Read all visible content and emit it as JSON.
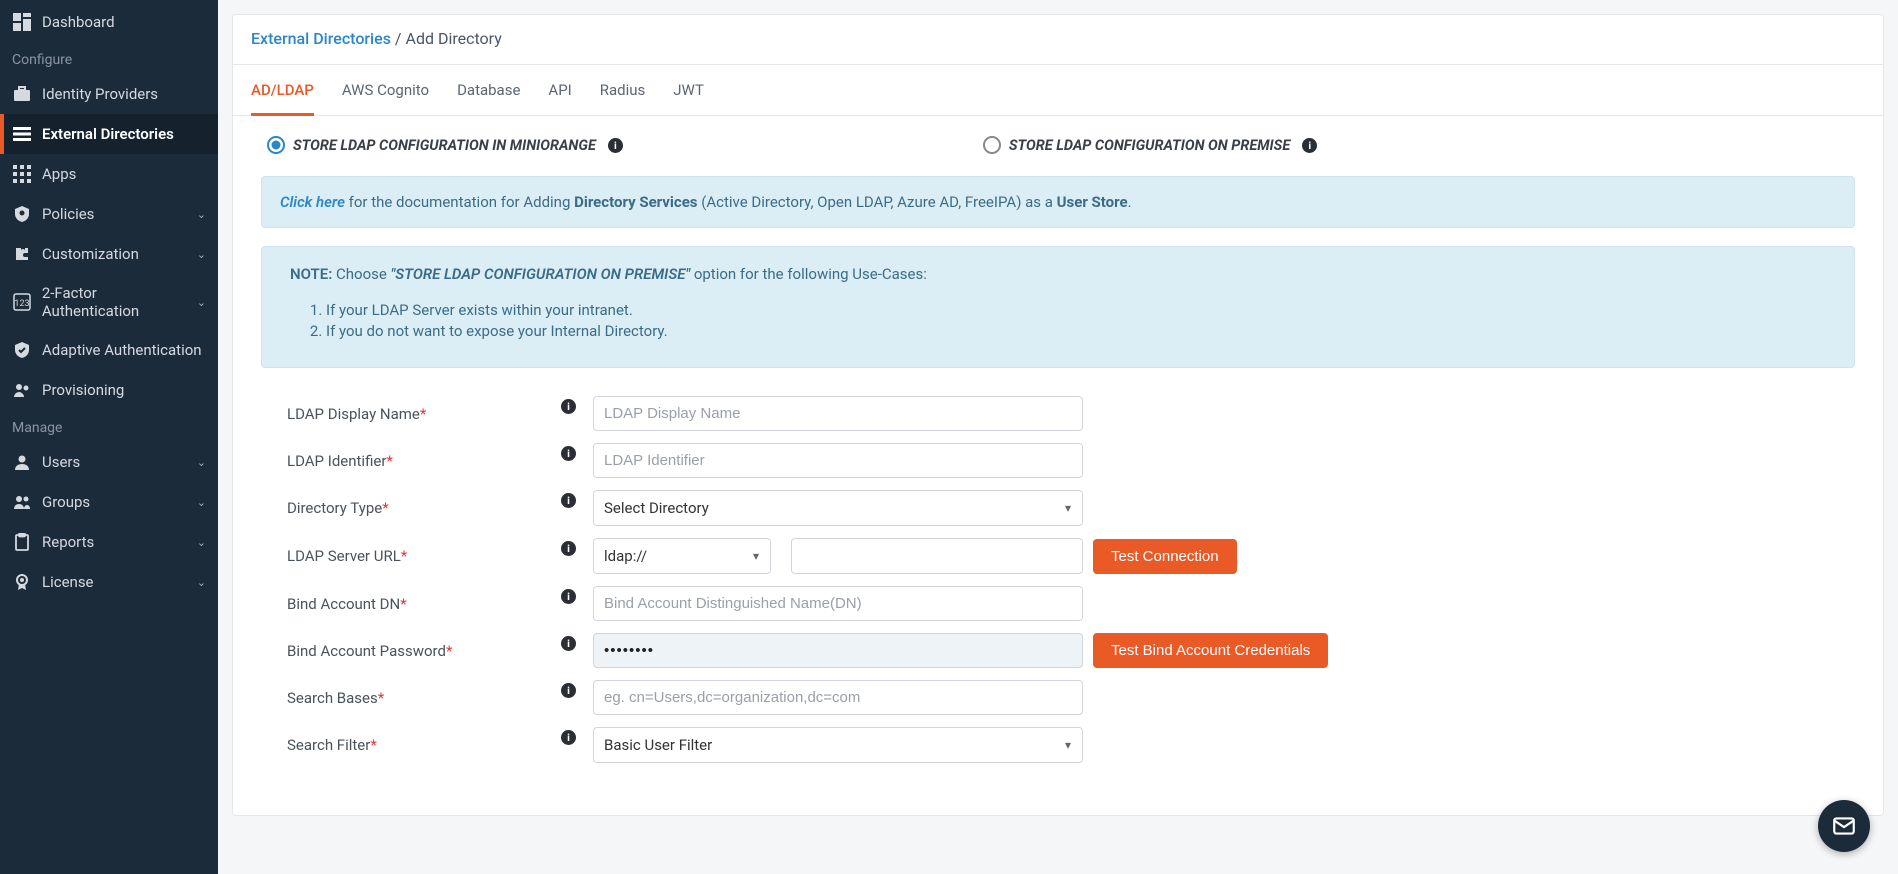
{
  "sidebar": {
    "items": [
      {
        "label": "Dashboard",
        "icon": "dashboard",
        "chev": false,
        "active": false
      },
      {
        "section": "Configure"
      },
      {
        "label": "Identity Providers",
        "icon": "briefcase",
        "chev": false,
        "active": false
      },
      {
        "label": "External Directories",
        "icon": "list",
        "chev": false,
        "active": true
      },
      {
        "label": "Apps",
        "icon": "grid",
        "chev": false,
        "active": false
      },
      {
        "label": "Policies",
        "icon": "shield-gear",
        "chev": true,
        "active": false
      },
      {
        "label": "Customization",
        "icon": "puzzle",
        "chev": true,
        "active": false
      },
      {
        "label": "2-Factor Authentication",
        "icon": "keypad",
        "chev": true,
        "active": false
      },
      {
        "label": "Adaptive Authentication",
        "icon": "shield-check",
        "chev": false,
        "active": false
      },
      {
        "label": "Provisioning",
        "icon": "users-gear",
        "chev": false,
        "active": false
      },
      {
        "section": "Manage"
      },
      {
        "label": "Users",
        "icon": "person",
        "chev": true,
        "active": false
      },
      {
        "label": "Groups",
        "icon": "people",
        "chev": true,
        "active": false
      },
      {
        "label": "Reports",
        "icon": "clipboard",
        "chev": true,
        "active": false
      },
      {
        "label": "License",
        "icon": "badge",
        "chev": true,
        "active": false
      }
    ]
  },
  "breadcrumb": {
    "link": "External Directories",
    "sep": " / ",
    "current": "Add Directory"
  },
  "tabs": [
    {
      "label": "AD/LDAP",
      "active": true
    },
    {
      "label": "AWS Cognito",
      "active": false
    },
    {
      "label": "Database",
      "active": false
    },
    {
      "label": "API",
      "active": false
    },
    {
      "label": "Radius",
      "active": false
    },
    {
      "label": "JWT",
      "active": false
    }
  ],
  "radios": {
    "opt1": "STORE LDAP CONFIGURATION IN MINIORANGE",
    "opt2": "STORE LDAP CONFIGURATION ON PREMISE",
    "selected": "opt1"
  },
  "alert": {
    "click_here": "Click here",
    "text1": " for the documentation for Adding ",
    "strong1": "Directory Services",
    "text2": " (Active Directory, Open LDAP, Azure AD, FreeIPA) as a ",
    "strong2": "User Store",
    "text3": "."
  },
  "note": {
    "title": "NOTE:",
    "pre": "  Choose ",
    "strong": "\"STORE LDAP CONFIGURATION ON PREMISE\"",
    "post": " option for the following Use-Cases:",
    "items": [
      "If your LDAP Server exists within your intranet.",
      "If you do not want to expose your Internal Directory."
    ]
  },
  "form": {
    "display_name": {
      "label": "LDAP Display Name",
      "placeholder": "LDAP Display Name"
    },
    "identifier": {
      "label": "LDAP Identifier",
      "placeholder": "LDAP Identifier"
    },
    "directory_type": {
      "label": "Directory Type",
      "selected": "Select Directory"
    },
    "server_url": {
      "label": "LDAP Server URL",
      "protocol": "ldap://",
      "value": ""
    },
    "bind_dn": {
      "label": "Bind Account DN",
      "placeholder": "Bind Account Distinguished Name(DN)"
    },
    "bind_pw": {
      "label": "Bind Account Password",
      "value": "••••••••"
    },
    "search_bases": {
      "label": "Search Bases",
      "placeholder": "eg. cn=Users,dc=organization,dc=com"
    },
    "search_filter": {
      "label": "Search Filter",
      "selected": "Basic User Filter"
    }
  },
  "buttons": {
    "test_connection": "Test Connection",
    "test_bind": "Test Bind Account Credentials"
  }
}
